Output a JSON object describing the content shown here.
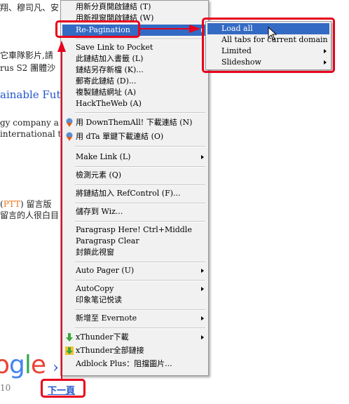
{
  "background": {
    "lines": [
      "翔、穆司凡、安",
      "它車隊影片,請",
      "rus S2 團體沙",
      "ainable Futur",
      "gy company a",
      "international tr",
      "PTT",
      "留言版",
      "留言的人很白目",
      "10"
    ],
    "google_logo": [
      "o",
      "g",
      "l",
      "e"
    ],
    "next_arrow": "›",
    "next_link": "下一頁"
  },
  "context_menu": {
    "items": [
      {
        "label": "用新分頁開啟鏈結 (T)"
      },
      {
        "label": "用新視窗開啟鏈結 (W)"
      },
      {
        "label": "Re-Pagination",
        "highlighted": true,
        "submenu": true
      },
      {
        "label": "Save Link to Pocket"
      },
      {
        "label": "此鏈結加入書籤 (L)"
      },
      {
        "label": "鏈結另存新檔 (K)..."
      },
      {
        "label": "郵寄此鏈結 (D)..."
      },
      {
        "label": "複製鏈結網址 (A)"
      },
      {
        "label": "HackTheWeb (A)"
      },
      {
        "label": "用 DownThemAll! 下載連結 (N)",
        "icon": "downthemall-icon"
      },
      {
        "label": "用 dTa 單鍵下載連結 (O)",
        "icon": "dta-onesclick-icon"
      },
      {
        "label": "Make Link (L)",
        "submenu": true
      },
      {
        "label": "檢測元素 (Q)"
      },
      {
        "label": "將鏈結加入 RefControl (F)..."
      },
      {
        "label": "儲存到 Wiz..."
      },
      {
        "label": "Paragrasp Here! Ctrl+Middle"
      },
      {
        "label": "Paragrasp Clear"
      },
      {
        "label": "封鎖此視窗"
      },
      {
        "label": "Auto Pager (U)",
        "submenu": true
      },
      {
        "label": "AutoCopy",
        "submenu": true
      },
      {
        "label": "印象笔记悦读"
      },
      {
        "label": "新增至 Evernote",
        "submenu": true
      },
      {
        "label": "xThunder下載",
        "icon": "xthunder-icon",
        "submenu": true
      },
      {
        "label": "xThunder全部鏈接",
        "icon": "xthunder-all-icon"
      },
      {
        "label": "Adblock Plus：阻擋圖片..."
      }
    ]
  },
  "submenu": {
    "items": [
      {
        "label": "Load all",
        "highlighted": true
      },
      {
        "label": "All tabs for current domain"
      },
      {
        "label": "Limited",
        "submenu": true
      },
      {
        "label": "Slideshow",
        "submenu": true
      }
    ]
  },
  "colors": {
    "highlight": "#336ac4",
    "annotation_red": "#e8001c",
    "link_blue": "#2255cc",
    "ptt_orange": "#e8761c"
  }
}
